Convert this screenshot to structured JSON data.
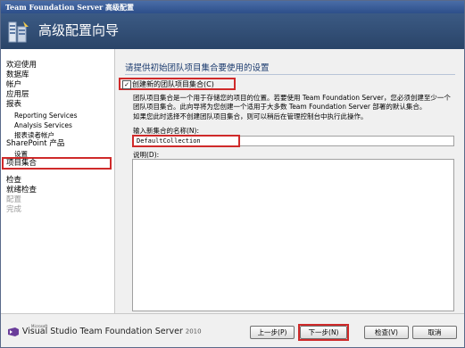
{
  "window": {
    "title": "Team Foundation Server 高级配置",
    "header_title": "高级配置向导",
    "header_icon": "server-wizard-icon"
  },
  "sidebar": {
    "items": [
      {
        "label": "欢迎使用",
        "state": "done"
      },
      {
        "label": "数据库",
        "state": "done"
      },
      {
        "label": "帐户",
        "state": "done"
      },
      {
        "label": "应用层",
        "state": "done"
      },
      {
        "label": "报表",
        "state": "done"
      },
      {
        "label": "Reporting Services",
        "state": "done",
        "sub": true
      },
      {
        "label": "Analysis Services",
        "state": "done",
        "sub": true
      },
      {
        "label": "报表读者帐户",
        "state": "done",
        "sub": true
      },
      {
        "label": "SharePoint 产品",
        "state": "done"
      },
      {
        "label": "设置",
        "state": "done",
        "sub": true
      },
      {
        "label": "项目集合",
        "state": "selected"
      },
      {
        "label": "检查",
        "state": "pending"
      },
      {
        "label": "就绪检查",
        "state": "pending"
      },
      {
        "label": "配置",
        "state": "disabled"
      },
      {
        "label": "完成",
        "state": "disabled"
      }
    ]
  },
  "main": {
    "section_title": "请提供初始团队项目集合要使用的设置",
    "create_checkbox": {
      "checked": true,
      "label": "创建新的团队项目集合(C)"
    },
    "description_line1": "团队项目集合是一个用于存储您的项目的位置。若要使用 Team Foundation Server，您必须创建至少一个团队项目集合。此向导将为您创建一个适用于大多数 Team Foundation Server 部署的默认集合。",
    "description_line2": "如果您此时选择不创建团队项目集合，则可以稍后在管理控制台中执行此操作。",
    "name_label": "输入新集合的名称(N):",
    "name_value": "DefaultCollection",
    "desc_label": "说明(D):",
    "desc_value": ""
  },
  "footer": {
    "logo_ms": "Microsoft",
    "logo_text": "Visual Studio Team Foundation Server",
    "logo_year": "2010",
    "prev_button": "上一步(P)",
    "next_button": "下一步(N)",
    "review_button": "检查(V)",
    "cancel_button": "取消"
  },
  "colors": {
    "highlight_box": "#cf2a2a",
    "header_bg": "#3b5a84",
    "title_bar": "#2d4f8a"
  }
}
